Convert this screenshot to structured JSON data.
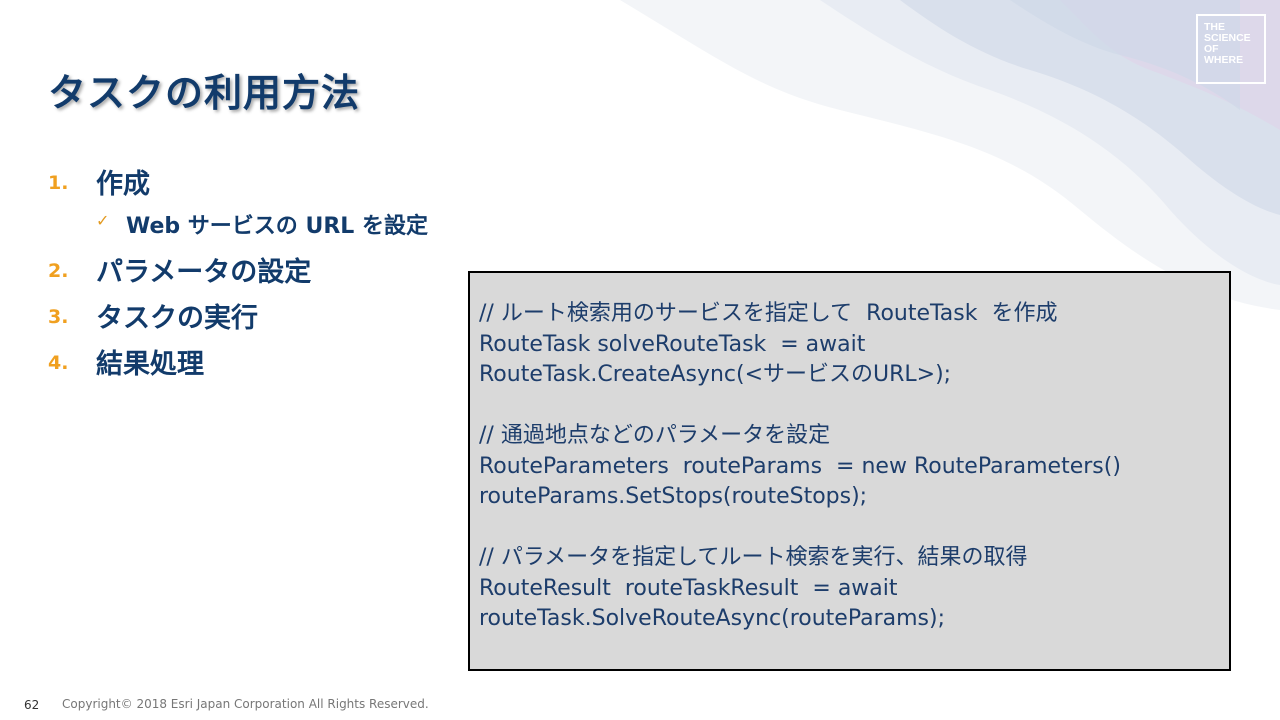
{
  "slide": {
    "title": "タスクの利用方法",
    "logo_lines": [
      "THE",
      "SCIENCE",
      "OF",
      "WHERE"
    ],
    "page_number": "62",
    "copyright": "Copyright© 2018 Esri Japan Corporation All Rights Reserved."
  },
  "steps": [
    {
      "num": "1.",
      "label": "作成",
      "sub": "Web サービスの URL を設定"
    },
    {
      "num": "2.",
      "label": "パラメータの設定"
    },
    {
      "num": "3.",
      "label": "タスクの実行"
    },
    {
      "num": "4.",
      "label": "結果処理"
    }
  ],
  "code_lines": [
    "// ルート検索用のサービスを指定して  RouteTask  を作成",
    "RouteTask solveRouteTask  = await",
    "RouteTask.CreateAsync(<サービスのURL>);",
    "",
    "// 通過地点などのパラメータを設定",
    "RouteParameters  routeParams  = new RouteParameters()",
    "routeParams.SetStops(routeStops);",
    "",
    "// パラメータを指定してルート検索を実行、結果の取得",
    "RouteResult  routeTaskResult  = await",
    "routeTask.SolveRouteAsync(routeParams);"
  ],
  "colors": {
    "title": "#123b6b",
    "accent_orange": "#f0a020",
    "code_bg": "#d9d9d9"
  }
}
